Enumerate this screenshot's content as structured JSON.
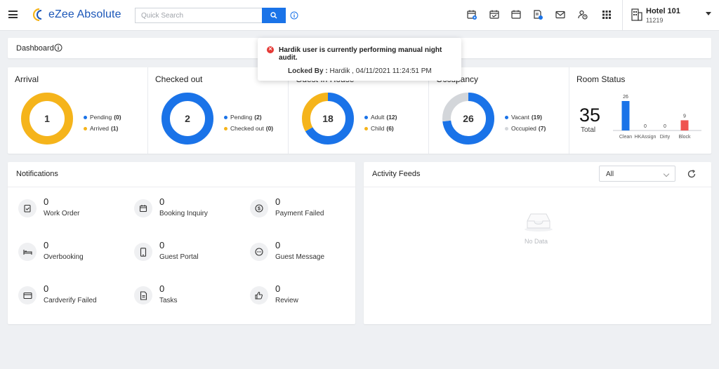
{
  "app": {
    "name": "eZee Absolute"
  },
  "search": {
    "placeholder": "Quick Search"
  },
  "top_icons": [
    "calendar-add-icon",
    "calendar-check-icon",
    "calendar-icon",
    "document-settings-icon",
    "mail-icon",
    "user-clock-icon",
    "apps-grid-icon"
  ],
  "hotel": {
    "name": "Hotel 101",
    "code": "11219"
  },
  "dashboard": {
    "title": "Dashboard"
  },
  "toast": {
    "message": "Hardik user is currently performing manual night audit.",
    "locked_by_label": "Locked By :",
    "locked_by_value": " Hardik , 04/11/2021 11:24:51 PM"
  },
  "stats": {
    "arrival": {
      "title": "Arrival",
      "total": "1",
      "items": [
        {
          "label": "Pending",
          "value": "(0)",
          "color": "#1a73e8"
        },
        {
          "label": "Arrived",
          "value": "(1)",
          "color": "#f5b41b"
        }
      ]
    },
    "checked_out": {
      "title": "Checked out",
      "total": "2",
      "items": [
        {
          "label": "Pending",
          "value": "(2)",
          "color": "#1a73e8"
        },
        {
          "label": "Checked out",
          "value": "(0)",
          "color": "#f5b41b"
        }
      ]
    },
    "guest_in_house": {
      "title": "Guest In House",
      "total": "18",
      "items": [
        {
          "label": "Adult",
          "value": "(12)",
          "color": "#1a73e8"
        },
        {
          "label": "Child",
          "value": "(6)",
          "color": "#f5b41b"
        }
      ]
    },
    "occupancy": {
      "title": "Occupancy",
      "total": "26",
      "items": [
        {
          "label": "Vacant",
          "value": "(19)",
          "color": "#1a73e8"
        },
        {
          "label": "Occupied",
          "value": "(7)",
          "color": "#d3d6da"
        }
      ]
    },
    "room_status": {
      "title": "Room Status",
      "total": "35",
      "total_label": "Total"
    }
  },
  "chart_data": {
    "type": "bar",
    "categories": [
      "Clean",
      "HKAssign",
      "Dirty",
      "Block"
    ],
    "values": [
      26,
      0,
      0,
      9
    ],
    "colors": [
      "#1a73e8",
      "#1a73e8",
      "#1a73e8",
      "#ef5350"
    ],
    "title": "Room Status"
  },
  "notifications": {
    "title": "Notifications",
    "items": [
      {
        "count": "0",
        "label": "Work Order",
        "icon": "clipboard-check-icon"
      },
      {
        "count": "0",
        "label": "Booking Inquiry",
        "icon": "calendar-icon"
      },
      {
        "count": "0",
        "label": "Payment Failed",
        "icon": "dollar-circle-icon"
      },
      {
        "count": "0",
        "label": "Overbooking",
        "icon": "bed-icon"
      },
      {
        "count": "0",
        "label": "Guest Portal",
        "icon": "mobile-icon"
      },
      {
        "count": "0",
        "label": "Guest Message",
        "icon": "chat-dots-icon"
      },
      {
        "count": "0",
        "label": "Cardverify Failed",
        "icon": "credit-card-icon"
      },
      {
        "count": "0",
        "label": "Tasks",
        "icon": "document-icon"
      },
      {
        "count": "0",
        "label": "Review",
        "icon": "thumbs-up-icon"
      }
    ]
  },
  "activity": {
    "title": "Activity Feeds",
    "filter": "All",
    "empty_text": "No Data"
  }
}
